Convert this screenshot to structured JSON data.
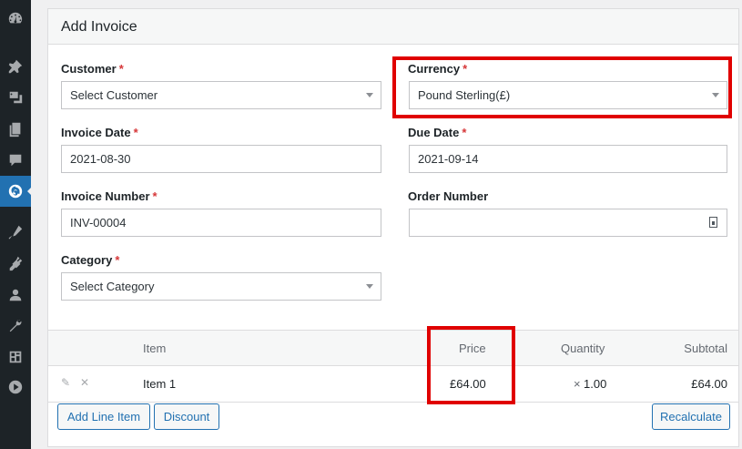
{
  "sidebar": {
    "icons": [
      "dashboard-icon",
      "pin-icon",
      "media-icon",
      "pages-icon",
      "comments-icon",
      "invoicing-icon",
      "appearance-icon",
      "plugins-icon",
      "users-icon",
      "tools-icon",
      "settings-icon",
      "play-icon"
    ]
  },
  "form": {
    "title": "Add Invoice",
    "customer": {
      "label": "Customer",
      "required": "*",
      "value": "Select Customer"
    },
    "currency": {
      "label": "Currency",
      "required": "*",
      "value": "Pound Sterling(£)"
    },
    "invoice_date": {
      "label": "Invoice Date",
      "required": "*",
      "value": "2021-08-30"
    },
    "due_date": {
      "label": "Due Date",
      "required": "*",
      "value": "2021-09-14"
    },
    "invoice_number": {
      "label": "Invoice Number",
      "required": "*",
      "value": "INV-00004"
    },
    "order_number": {
      "label": "Order Number",
      "value": ""
    },
    "category": {
      "label": "Category",
      "required": "*",
      "value": "Select Category"
    }
  },
  "table": {
    "headers": {
      "item": "Item",
      "price": "Price",
      "quantity": "Quantity",
      "subtotal": "Subtotal"
    },
    "rows": [
      {
        "item": "Item 1",
        "price": "£64.00",
        "qty_prefix": "×",
        "quantity": "1.00",
        "subtotal": "£64.00"
      }
    ]
  },
  "buttons": {
    "add_line_item": "Add Line Item",
    "discount": "Discount",
    "recalculate": "Recalculate"
  },
  "colors": {
    "accent": "#2271b1",
    "highlight": "#e00000",
    "sidebar": "#1d2327"
  }
}
